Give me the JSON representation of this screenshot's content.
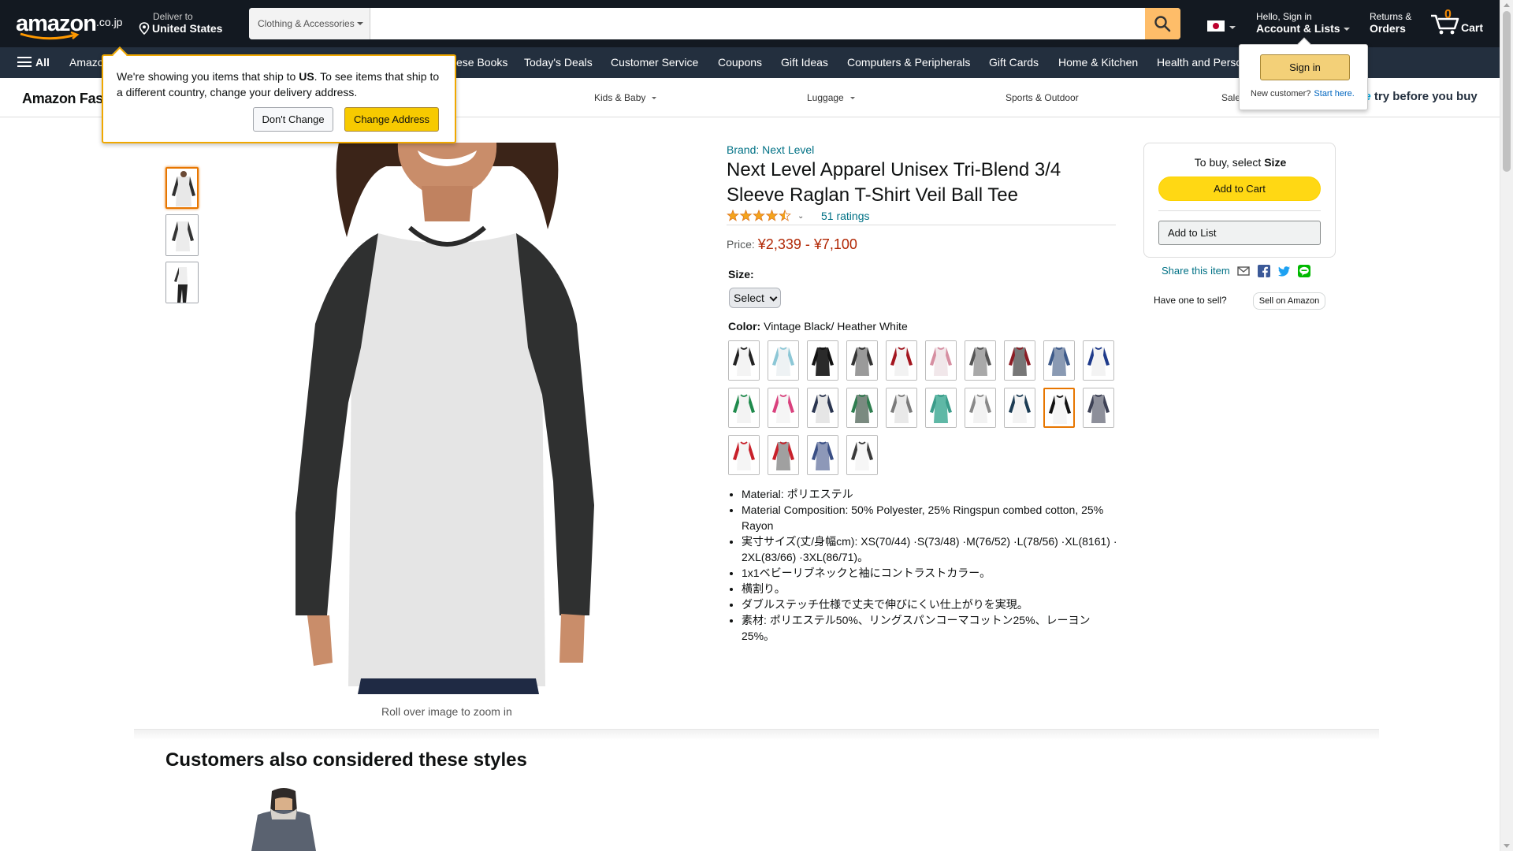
{
  "colors": {
    "nav_bg": "#131921",
    "subnav_bg": "#232f3e",
    "accent": "#febd69",
    "price": "#b12704",
    "link": "#007185",
    "button_yellow": "#ffd814"
  },
  "header": {
    "logo_word": "amazon",
    "logo_tld": ".co.jp",
    "deliver_line1": "Deliver to",
    "deliver_line2": "United States",
    "search_category": "Clothing & Accessories",
    "search_placeholder": "",
    "flag_icon": "japan-flag-icon",
    "account_line1": "Hello, Sign in",
    "account_line2": "Account & Lists",
    "returns_line1": "Returns &",
    "returns_line2": "Orders",
    "cart_count": "0",
    "cart_label": "Cart"
  },
  "subnav": {
    "all_label": "All",
    "items": [
      "Amazon",
      "Japanese Books",
      "Today's Deals",
      "Customer Service",
      "Coupons",
      "Gift Ideas",
      "Computers & Peripherals",
      "Gift Cards",
      "Home & Kitchen",
      "Health and Personal Care"
    ],
    "truncated_labels": [
      "Amazo",
      "ese Books",
      "Health and Perso"
    ]
  },
  "fashion_bar": {
    "brand": "Amazon Fas",
    "items": [
      "Kids & Baby",
      "Luggage",
      "Sports & Outdoor",
      "Sale"
    ],
    "try_before_prefix": "me",
    "try_before": " try before you buy"
  },
  "ship_popover": {
    "message_pre": "We're showing you items that ship to ",
    "message_country": "US",
    "message_post": ". To see items that ship to a different country, change your delivery address.",
    "dont_change": "Don't Change",
    "change_address": "Change Address"
  },
  "signin_popover": {
    "button": "Sign in",
    "new_customer": "New customer?",
    "start_here": "Start here."
  },
  "gallery": {
    "thumbnail_count": 3,
    "selected_index": 0,
    "rollover_hint": "Roll over image to zoom in"
  },
  "product": {
    "brand_link": "Brand: Next Level",
    "title": "Next Level Apparel Unisex Tri-Blend 3/4 Sleeve Raglan T-Shirt Veil Ball Tee",
    "stars": 4.5,
    "ratings_text": "51 ratings",
    "price_label": "Price:",
    "price_range": "¥2,339 - ¥7,100",
    "size_label": "Size:",
    "size_selected": "Select",
    "color_label": "Color:",
    "color_selected": "Vintage Black/ Heather White",
    "swatches": [
      {
        "body": "#f4f4f4",
        "sleeve": "#222222"
      },
      {
        "body": "#eef2f4",
        "sleeve": "#8cc7d6"
      },
      {
        "body": "#2a2a2a",
        "sleeve": "#111111"
      },
      {
        "body": "#9a9a9a",
        "sleeve": "#333333"
      },
      {
        "body": "#f2f2f2",
        "sleeve": "#a3161f"
      },
      {
        "body": "#f1e7ea",
        "sleeve": "#d68ea1"
      },
      {
        "body": "#a9a9a9",
        "sleeve": "#555555"
      },
      {
        "body": "#777777",
        "sleeve": "#8c1c24"
      },
      {
        "body": "#8a9ab3",
        "sleeve": "#3d5a8a"
      },
      {
        "body": "#f3f3f3",
        "sleeve": "#1e3a8a"
      },
      {
        "body": "#f3f3f3",
        "sleeve": "#1f8a4c"
      },
      {
        "body": "#f5f5f5",
        "sleeve": "#d9417d"
      },
      {
        "body": "#e6e6e6",
        "sleeve": "#2a3550"
      },
      {
        "body": "#7a8a80",
        "sleeve": "#2e7d4f"
      },
      {
        "body": "#e9e9e9",
        "sleeve": "#7a7a7a"
      },
      {
        "body": "#5fb8a6",
        "sleeve": "#3b9c8a"
      },
      {
        "body": "#f2f2f2",
        "sleeve": "#888888"
      },
      {
        "body": "#f3f3f3",
        "sleeve": "#1c3c54"
      },
      {
        "body": "#f5f5f5",
        "sleeve": "#111111"
      },
      {
        "body": "#8d8f9a",
        "sleeve": "#3d4155"
      },
      {
        "body": "#f5f5f5",
        "sleeve": "#c8202a"
      },
      {
        "body": "#a0a0a0",
        "sleeve": "#c8202a"
      },
      {
        "body": "#8d98b8",
        "sleeve": "#3a4f85"
      },
      {
        "body": "#f6f6f6",
        "sleeve": "#3a3a3a"
      }
    ],
    "selected_swatch": 18,
    "bullets": [
      "Material: ポリエステル",
      "Material Composition: 50% Polyester, 25% Ringspun combed cotton, 25% Rayon",
      "実寸サイズ(丈/身幅cm): XS(70/44) ·S(73/48) ·M(76/52) ·L(78/56) ·XL(8161) · 2XL(83/66) ·3XL(86/71)。",
      "1x1ベビーリブネックと袖にコントラストカラー。",
      "横割り。",
      "ダブルステッチ仕様で丈夫で伸びにくい仕上がりを実現。",
      "素材: ポリエステル50%、リングスパンコーマコットン25%、レーヨン 25%。"
    ]
  },
  "buybox": {
    "to_buy_pre": "To buy, select ",
    "to_buy_bold": "Size",
    "add_to_cart": "Add to Cart",
    "add_to_list": "Add to List",
    "share": "Share this item",
    "share_icons": [
      "email-icon",
      "facebook-icon",
      "twitter-icon",
      "line-icon"
    ],
    "have_one": "Have one to sell?",
    "sell_on_amazon": "Sell on Amazon"
  },
  "also_considered": {
    "heading": "Customers also considered these styles"
  }
}
